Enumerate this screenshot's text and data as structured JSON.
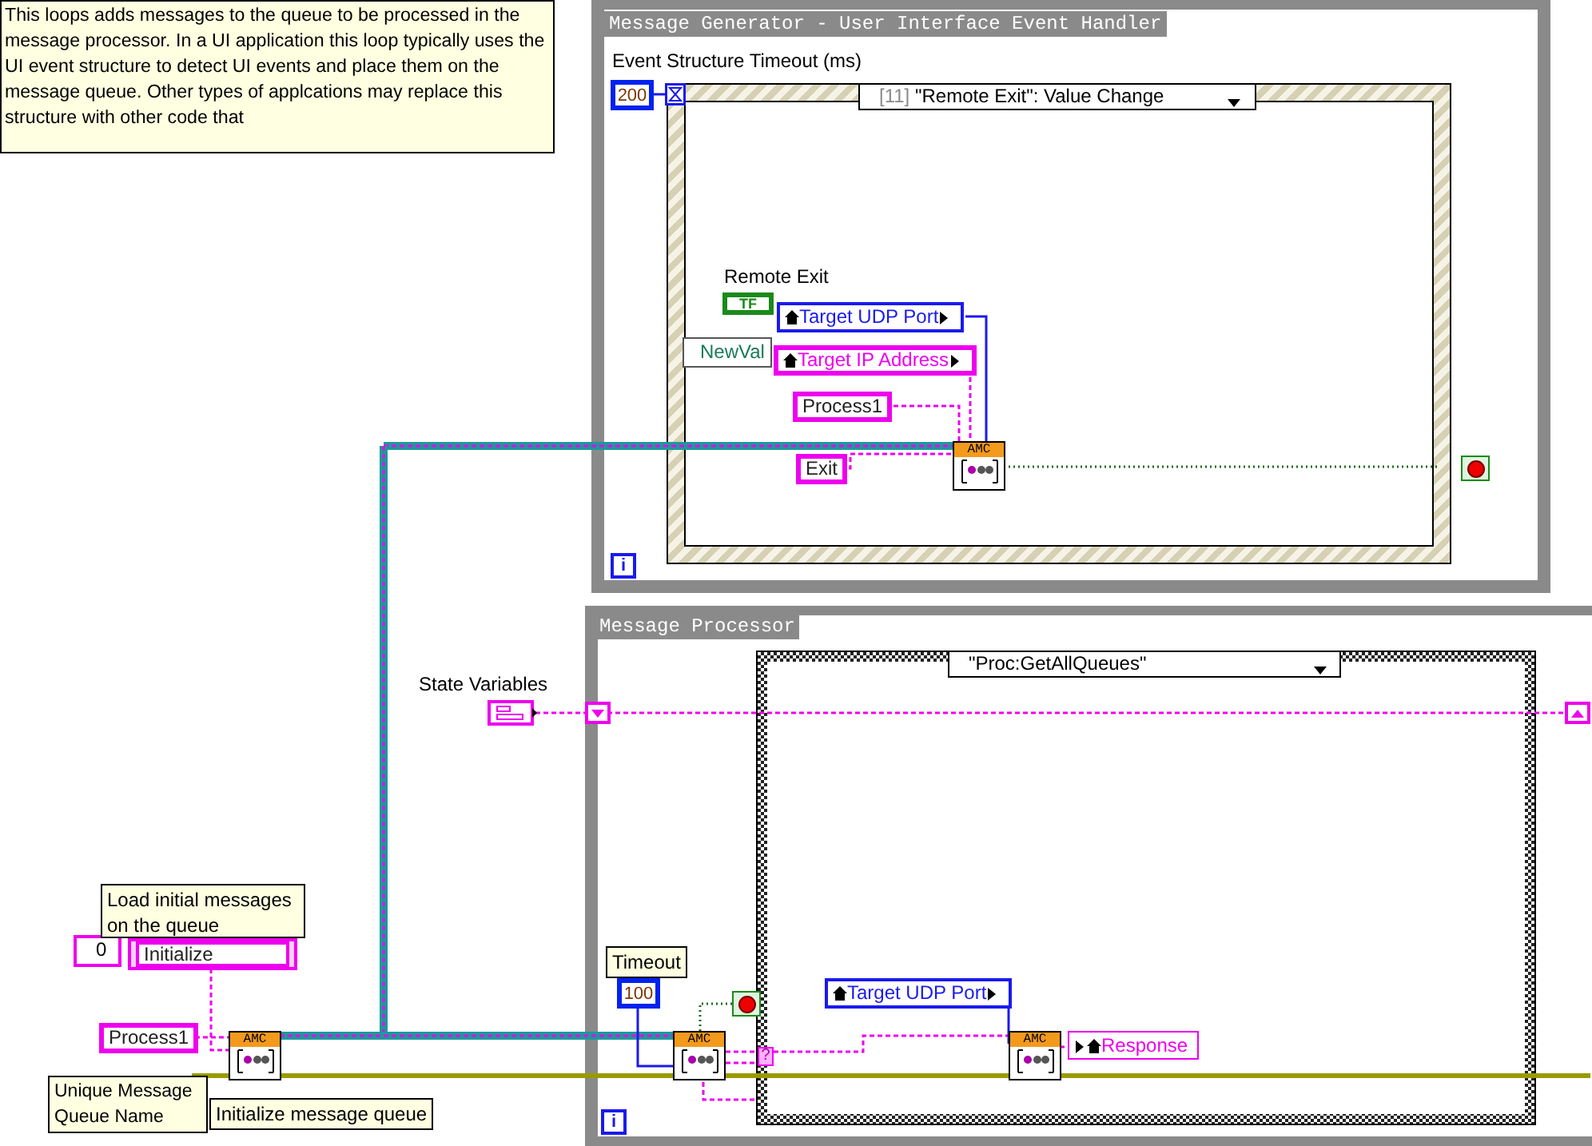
{
  "comment": {
    "text": "This loops adds messages to the queue to be processed in the message processor. In a UI application this loop typically uses the UI event structure to detect UI events and place them on the message queue. Other types of applcations may replace this structure with other code that"
  },
  "generator_loop": {
    "title": "Message Generator - User Interface Event Handler",
    "timeout_label": "Event Structure Timeout (ms)",
    "timeout_value": "200",
    "case_index": "[11]",
    "case_label": "\"Remote Exit\": Value Change",
    "remote_exit_label": "Remote Exit",
    "remote_exit_constant": "TF",
    "event_data": "NewVal",
    "property_nodes": [
      {
        "text": "Target UDP Port",
        "kind": "numeric"
      },
      {
        "text": "Target IP Address",
        "kind": "string"
      }
    ],
    "constants": [
      "Process1",
      "Exit"
    ],
    "subvi_banner": "AMC",
    "iteration": "i"
  },
  "processor_loop": {
    "title": "Message Processor",
    "state_label": "State Variables",
    "case_label": "\"Proc:GetAllQueues\"",
    "timeout_label": "Timeout",
    "timeout_value": "100",
    "property_node": "Target UDP Port",
    "indicator": "Response",
    "subvi_banners": [
      "AMC",
      "AMC"
    ],
    "tunnel_mark": "?",
    "iteration": "i"
  },
  "init": {
    "comment": "Load initial messages on the queue",
    "array_index": "0",
    "array_items": [
      "Initialize"
    ],
    "queue_name": "Process1",
    "subvi_banner": "AMC",
    "name_comment": "Unique Message Queue Name",
    "init_comment": "Initialize message queue"
  }
}
